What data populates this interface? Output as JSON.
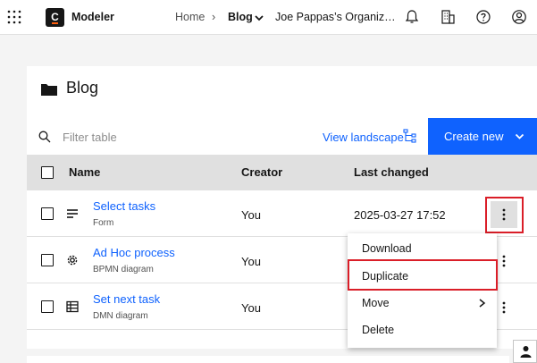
{
  "topbar": {
    "app_name": "Modeler",
    "logo_letter": "C",
    "breadcrumb": {
      "home": "Home",
      "separator": "›",
      "current": "Blog",
      "org": "Joe Pappas’s Organiz…"
    },
    "icons": [
      "apps-grid-icon",
      "notification-bell-icon",
      "organization-icon",
      "help-icon",
      "user-profile-icon"
    ]
  },
  "page": {
    "title": "Blog",
    "filter_placeholder": "Filter table",
    "view_landscape": "View landscape",
    "create_new": "Create new"
  },
  "table": {
    "columns": [
      "Name",
      "Creator",
      "Last changed"
    ],
    "rows": [
      {
        "name": "Select tasks",
        "type": "Form",
        "icon": "form-icon",
        "creator": "You",
        "changed": "2025-03-27 17:52"
      },
      {
        "name": "Ad Hoc process",
        "type": "BPMN diagram",
        "icon": "bpmn-gear-icon",
        "creator": "You",
        "changed": ""
      },
      {
        "name": "Set next task",
        "type": "DMN diagram",
        "icon": "dmn-table-icon",
        "creator": "You",
        "changed": ""
      }
    ]
  },
  "context_menu": {
    "items": [
      "Download",
      "Duplicate",
      "Move",
      "Delete"
    ]
  },
  "colors": {
    "primary": "#0f62fe",
    "highlight": "#da1e28",
    "header_bg": "#e0e0e0",
    "brand_accent": "#fc5d0d"
  }
}
